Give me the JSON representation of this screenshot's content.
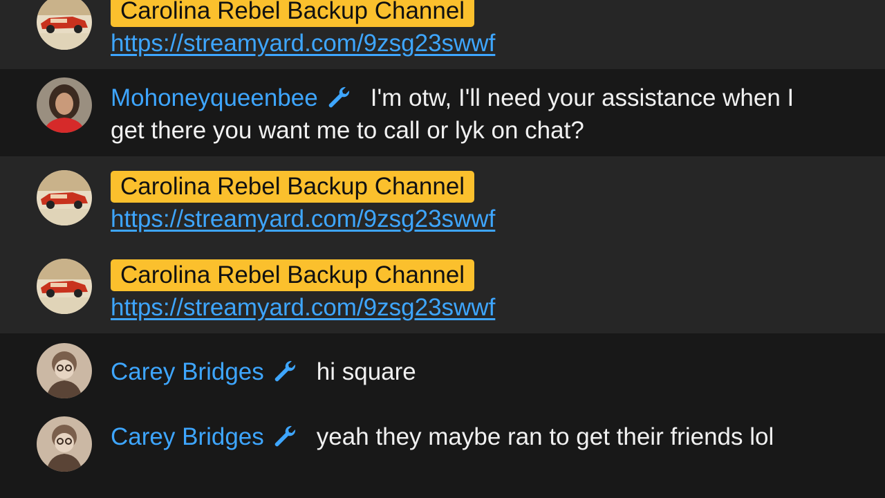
{
  "colors": {
    "owner_badge_bg": "#fbc02d",
    "author_blue": "#3ea6ff",
    "link_blue": "#3ea6ff",
    "message_text": "#f1f1f1",
    "row_dark": "#181818",
    "row_highlight": "#262626"
  },
  "messages": [
    {
      "author": "Carolina Rebel Backup Channel",
      "author_type": "owner",
      "avatar_icon": "car-avatar-icon",
      "link": "https://streamyard.com/9zsg23swwf"
    },
    {
      "author": "Mohoneyqueenbee",
      "author_type": "moderator",
      "badge_icon": "wrench-icon",
      "avatar_icon": "woman-avatar-icon",
      "text": "I'm otw, I'll need your assistance when I get there you want me to call or lyk on chat?"
    },
    {
      "author": "Carolina Rebel Backup Channel",
      "author_type": "owner",
      "avatar_icon": "car-avatar-icon",
      "link": "https://streamyard.com/9zsg23swwf"
    },
    {
      "author": "Carolina Rebel Backup Channel",
      "author_type": "owner",
      "avatar_icon": "car-avatar-icon",
      "link": "https://streamyard.com/9zsg23swwf"
    },
    {
      "author": "Carey Bridges",
      "author_type": "moderator",
      "badge_icon": "wrench-icon",
      "avatar_icon": "man-avatar-icon",
      "text": "hi square"
    },
    {
      "author": "Carey Bridges",
      "author_type": "moderator",
      "badge_icon": "wrench-icon",
      "avatar_icon": "man-avatar-icon",
      "text": "yeah they maybe ran to get their friends lol"
    }
  ]
}
